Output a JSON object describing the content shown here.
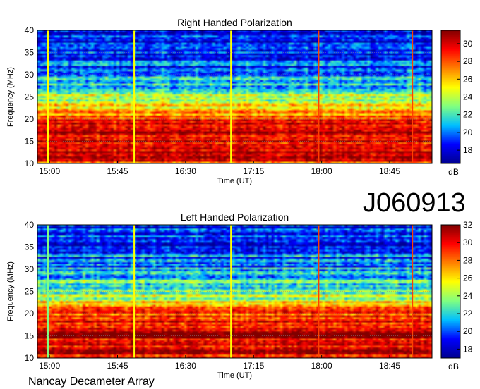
{
  "figure": {
    "id_label": "J060913",
    "footer": "Nancay Decameter Array"
  },
  "colormap": {
    "stops": [
      "#00008f",
      "#0000ff",
      "#00bfff",
      "#80ff80",
      "#ffff00",
      "#ff8000",
      "#ff0000",
      "#800000"
    ]
  },
  "chart_data": [
    {
      "type": "heatmap",
      "title": "Right Handed Polarization",
      "xlabel": "Time (UT)",
      "ylabel": "Frequency (MHz)",
      "xlim": [
        "14:52",
        "19:13"
      ],
      "ylim": [
        10,
        40
      ],
      "x_ticks": [
        "15:00",
        "15:45",
        "16:30",
        "17:15",
        "18:00",
        "18:45"
      ],
      "y_ticks": [
        10,
        15,
        20,
        25,
        30,
        35,
        40
      ],
      "colorbar": {
        "label": "dB",
        "range": [
          16.5,
          31.5
        ],
        "ticks": [
          18,
          20,
          22,
          24,
          26,
          28,
          30
        ]
      },
      "intensity_profile": {
        "frequency_mhz": [
          10,
          12,
          14,
          16,
          18,
          20,
          22,
          24,
          26,
          28,
          30,
          32,
          34,
          36,
          38,
          40
        ],
        "level_db": [
          29,
          30,
          30.5,
          30.5,
          30,
          29,
          26,
          24,
          22.5,
          21,
          20,
          19.5,
          19,
          18.5,
          18,
          18
        ]
      },
      "time_features": [
        {
          "time": "14:59",
          "color": "#ffff00"
        },
        {
          "time": "15:56",
          "color": "#ffff00"
        },
        {
          "time": "17:00",
          "color": "#ffff00"
        },
        {
          "time": "17:58",
          "color": "#ff4000"
        },
        {
          "time": "19:00",
          "color": "#ff4000"
        }
      ]
    },
    {
      "type": "heatmap",
      "title": "Left Handed Polarization",
      "xlabel": "Time (UT)",
      "ylabel": "Frequency (MHz)",
      "xlim": [
        "14:52",
        "19:13"
      ],
      "ylim": [
        10,
        40
      ],
      "x_ticks": [
        "15:00",
        "15:45",
        "16:30",
        "17:15",
        "18:00",
        "18:45"
      ],
      "y_ticks": [
        10,
        15,
        20,
        25,
        30,
        35,
        40
      ],
      "colorbar": {
        "label": "dB",
        "range": [
          17,
          32
        ],
        "ticks": [
          18,
          20,
          22,
          24,
          26,
          28,
          30,
          32
        ]
      },
      "intensity_profile": {
        "frequency_mhz": [
          10,
          12,
          14,
          16,
          18,
          20,
          22,
          24,
          26,
          28,
          30,
          32,
          34,
          36,
          38,
          40
        ],
        "level_db": [
          30,
          31,
          31,
          30.5,
          30,
          28.5,
          26,
          24.5,
          23,
          22,
          21,
          20.5,
          20,
          19.5,
          19,
          19
        ]
      },
      "time_features": [
        {
          "time": "14:59",
          "color": "#80ff80"
        },
        {
          "time": "15:56",
          "color": "#ffff00"
        },
        {
          "time": "17:00",
          "color": "#ffff00"
        },
        {
          "time": "17:58",
          "color": "#ff4000"
        },
        {
          "time": "19:00",
          "color": "#ff4000"
        }
      ]
    }
  ]
}
